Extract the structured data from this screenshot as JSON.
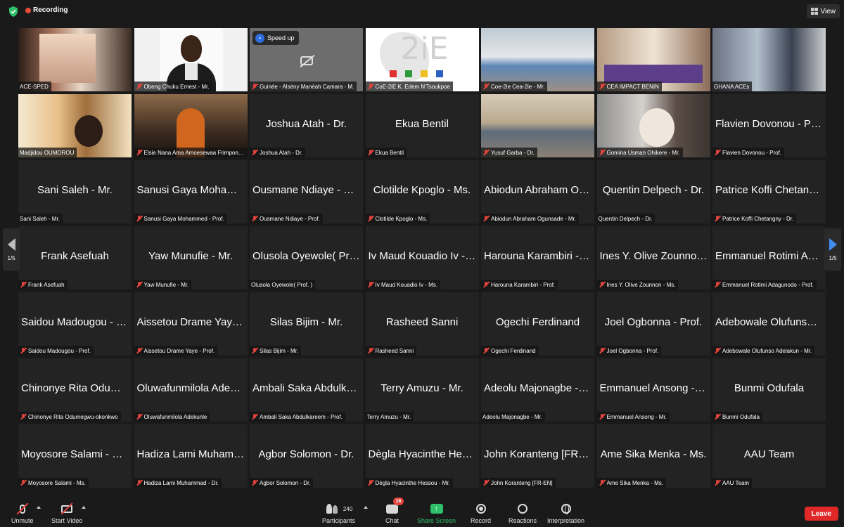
{
  "topbar": {
    "recording_label": "Recording",
    "view_label": "View"
  },
  "tiles": [
    {
      "big": "",
      "label": "ACE-SPED",
      "muted": false,
      "video": "room1"
    },
    {
      "big": "",
      "label": "Obeng Chuku Ernest - Mr.",
      "muted": true,
      "video": "portrait"
    },
    {
      "big": "",
      "label": "Guinée - Alsény Manéah Camara - M.",
      "muted": true,
      "video": "grey",
      "overlay": "Speed up"
    },
    {
      "big": "",
      "label": "CoE-2iE K. Edem N'Tsoukpoe",
      "muted": true,
      "video": "logo",
      "logo_text": "2iE"
    },
    {
      "big": "",
      "label": "Coe-2ie Cea-2ie - Mr.",
      "muted": true,
      "video": "room2"
    },
    {
      "big": "",
      "label": "CEA IMPACT BENIN",
      "muted": true,
      "video": "room3"
    },
    {
      "big": "",
      "label": "GHANA ACEs",
      "muted": false,
      "video": "room4",
      "speaking": true
    },
    {
      "big": "",
      "label": "Madjidou OUMOROU",
      "muted": false,
      "video": "room5"
    },
    {
      "big": "",
      "label": "Elsie Nana Ama Amoesewaa Frimpong - Ms.",
      "muted": true,
      "video": "orange"
    },
    {
      "big": "Joshua Atah - Dr.",
      "label": "Joshua Atah - Dr.",
      "muted": true
    },
    {
      "big": "Ekua Bentil",
      "label": "Ekua Bentil",
      "muted": true
    },
    {
      "big": "",
      "label": "Yusuf Garba - Dr.",
      "muted": true,
      "video": "conf"
    },
    {
      "big": "",
      "label": "Gomina Usman Ohikere - Mr.",
      "muted": true,
      "video": "face"
    },
    {
      "big": "Flavien Dovonou - Prof.",
      "label": "Flavien Dovonou - Prof.",
      "muted": true
    },
    {
      "big": "Sani Saleh - Mr.",
      "label": "Sani Saleh - Mr.",
      "muted": false
    },
    {
      "big": "Sanusi Gaya Mohammed - Prof.",
      "label": "Sanusi Gaya Mohammed - Prof.",
      "muted": true
    },
    {
      "big": "Ousmane Ndiaye - Prof.",
      "label": "Ousmane Ndiaye - Prof.",
      "muted": true
    },
    {
      "big": "Clotilde Kpoglo - Ms.",
      "label": "Clotilde Kpoglo - Ms.",
      "muted": true
    },
    {
      "big": "Abiodun Abraham Ogunsade - Mr.",
      "label": "Abiodun Abraham Ogunsade - Mr.",
      "muted": true
    },
    {
      "big": "Quentin Delpech - Dr.",
      "label": "Quentin Delpech - Dr.",
      "muted": false
    },
    {
      "big": "Patrice Koffi Chetangny - Dr.",
      "label": "Patrice Koffi Chetangny - Dr.",
      "muted": true
    },
    {
      "big": "Frank Asefuah",
      "label": "Frank Asefuah",
      "muted": true
    },
    {
      "big": "Yaw Munufie - Mr.",
      "label": "Yaw Munufie - Mr.",
      "muted": true
    },
    {
      "big": "Olusola Oyewole( Prof. )",
      "label": "Olusola Oyewole( Prof. )",
      "muted": false
    },
    {
      "big": "Iv Maud Kouadio Iv - Ms.",
      "label": "Iv Maud Kouadio Iv - Ms.",
      "muted": true
    },
    {
      "big": "Harouna Karambiri - Prof.",
      "label": "Harouna Karambiri - Prof.",
      "muted": true
    },
    {
      "big": "Ines Y. Olive Zounnon - Ms.",
      "label": "Ines Y. Olive Zounnon - Ms.",
      "muted": true
    },
    {
      "big": "Emmanuel Rotimi Adagunodo - Prof.",
      "label": "Emmanuel Rotimi Adagunodo - Prof.",
      "muted": true
    },
    {
      "big": "Saidou Madougou - Prof.",
      "label": "Saidou Madougou - Prof.",
      "muted": true
    },
    {
      "big": "Aissetou Drame Yaye - Prof.",
      "label": "Aissetou Drame Yaye - Prof.",
      "muted": true
    },
    {
      "big": "Silas Bijim - Mr.",
      "label": "Silas Bijim - Mr.",
      "muted": true
    },
    {
      "big": "Rasheed Sanni",
      "label": "Rasheed Sanni",
      "muted": true
    },
    {
      "big": "Ogechi Ferdinand",
      "label": "Ogechi Ferdinand",
      "muted": true
    },
    {
      "big": "Joel Ogbonna - Prof.",
      "label": "Joel Ogbonna - Prof.",
      "muted": true
    },
    {
      "big": "Adebowale Olufunso Adelakun - Mr.",
      "label": "Adebowale Olufunso Adelakun - Mr.",
      "muted": true
    },
    {
      "big": "Chinonye Rita Odumegwu-okonkwo",
      "label": "Chinonye Rita Odumegwu-okonkwo",
      "muted": true
    },
    {
      "big": "Oluwafunmilola Adekunle",
      "label": "Oluwafunmilola Adekunle",
      "muted": true
    },
    {
      "big": "Ambali Saka Abdulkareem - Prof.",
      "label": "Ambali Saka Abdulkareem - Prof.",
      "muted": true
    },
    {
      "big": "Terry Amuzu - Mr.",
      "label": "Terry Amuzu - Mr.",
      "muted": false
    },
    {
      "big": "Adeolu Majonagbe - Mr.",
      "label": "Adeolu Majonagbe - Mr.",
      "muted": false
    },
    {
      "big": "Emmanuel Ansong - Mr.",
      "label": "Emmanuel Ansong - Mr.",
      "muted": true
    },
    {
      "big": "Bunmi Odufala",
      "label": "Bunmi Odufala",
      "muted": true
    },
    {
      "big": "Moyosore Salami - Ms.",
      "label": "Moyosore Salami - Ms.",
      "muted": true
    },
    {
      "big": "Hadiza Lami Muhammad - Dr.",
      "label": "Hadiza Lami Muhammad - Dr.",
      "muted": true
    },
    {
      "big": "Agbor Solomon - Dr.",
      "label": "Agbor Solomon - Dr.",
      "muted": true
    },
    {
      "big": "Dègla Hyacinthe Hessou - Mr.",
      "label": "Dègla Hyacinthe Hessou - Mr.",
      "muted": true
    },
    {
      "big": "John Koranteng [FR-EN]",
      "label": "John Koranteng [FR-EN]",
      "muted": true
    },
    {
      "big": "Ame Sika Menka - Ms.",
      "label": "Ame Sika Menka - Ms.",
      "muted": true
    },
    {
      "big": "AAU Team",
      "label": "AAU Team",
      "muted": true
    }
  ],
  "pager": {
    "left": "1/5",
    "right": "1/5"
  },
  "toolbar": {
    "unmute": "Unmute",
    "start_video": "Start Video",
    "participants": "Participants",
    "participants_count": "240",
    "chat": "Chat",
    "chat_badge": "16",
    "share_screen": "Share Screen",
    "record": "Record",
    "reactions": "Reactions",
    "interpretation": "Interpretation",
    "leave": "Leave"
  },
  "colors": {
    "record_red": "#e64b3c",
    "speaking_outline": "#c8d94a",
    "share_green": "#2ec06a",
    "leave_red": "#e02828",
    "page_arrow_blue": "#3f8ef0"
  }
}
